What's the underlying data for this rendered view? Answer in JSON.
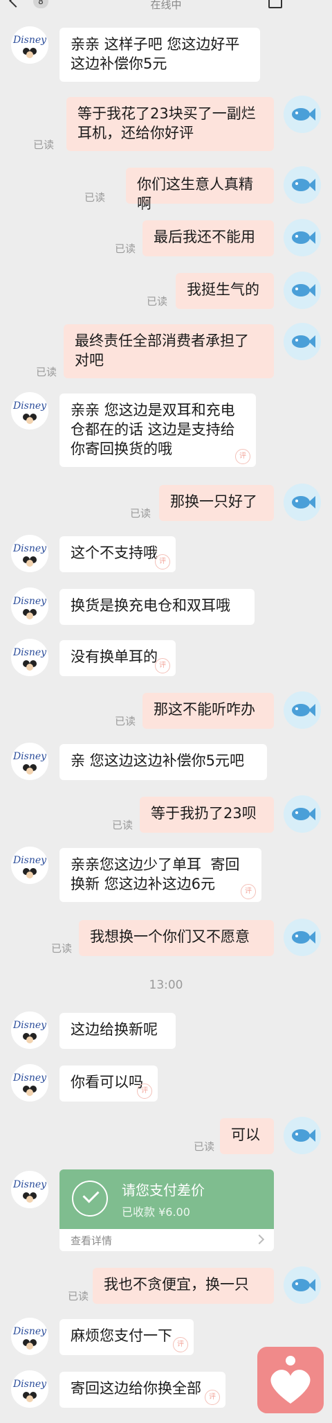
{
  "header": {
    "status": "在线中",
    "unread_count": "8"
  },
  "read_label": "已读",
  "messages": [
    {
      "side": "in",
      "text": "亲亲 这样子吧 您这边好平\n这边补偿你5元"
    },
    {
      "side": "out",
      "text": "等于我花了23块买了一副烂\n耳机，还给你好评",
      "read": "已读"
    },
    {
      "side": "out",
      "text": "你们这生意人真精啊",
      "read": "已读"
    },
    {
      "side": "out",
      "text": "最后我还不能用",
      "read": "已读"
    },
    {
      "side": "out",
      "text": "我挺生气的",
      "read": "已读"
    },
    {
      "side": "out",
      "text": "最终责任全部消费者承担了\n对吧",
      "read": "已读"
    },
    {
      "side": "in",
      "text": "亲亲 您这边是双耳和充电\n仓都在的话 这边是支持给\n你寄回换货的哦"
    },
    {
      "side": "out",
      "text": "那换一只好了",
      "read": "已读"
    },
    {
      "side": "in",
      "text": "这个不支持哦"
    },
    {
      "side": "in",
      "text": "换货是换充电仓和双耳哦"
    },
    {
      "side": "in",
      "text": "没有换单耳的"
    },
    {
      "side": "out",
      "text": "那这不能听咋办",
      "read": "已读"
    },
    {
      "side": "in",
      "text": "亲 您这边这边补偿你5元吧"
    },
    {
      "side": "out",
      "text": "等于我扔了23呗",
      "read": "已读"
    },
    {
      "side": "in",
      "text": "亲亲您这边少了单耳  寄回\n换新 您这边补这边6元"
    },
    {
      "side": "out",
      "text": "我想换一个你们又不愿意",
      "read": "已读"
    },
    {
      "side": "in",
      "text": "这边给换新呢"
    },
    {
      "side": "in",
      "text": "你看可以吗"
    },
    {
      "side": "out",
      "text": "可以",
      "read": "已读"
    },
    {
      "side": "out",
      "text": "我也不贪便宜，换一只",
      "read": "已读"
    },
    {
      "side": "in",
      "text": "麻烦您支付一下"
    },
    {
      "side": "in",
      "text": "寄回这边给你换全部"
    }
  ],
  "timestamp": "13:00",
  "payment_card": {
    "title": "请您支付差价",
    "subtitle": "已收款 ¥6.00",
    "detail_link": "查看详情"
  },
  "avatar_left_text": "Disney",
  "stamp_char": "评",
  "colors": {
    "bubble_out": "#fde3dc",
    "bubble_in": "#ffffff",
    "pay_green": "#7fbd8f",
    "heart_bg": "#f08a8a"
  }
}
